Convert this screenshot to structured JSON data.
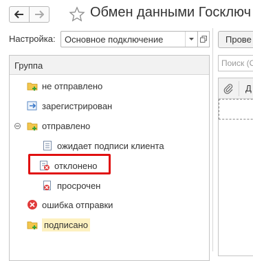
{
  "header": {
    "title": "Обмен данными Госключ"
  },
  "settings": {
    "label": "Настройка:",
    "selected": "Основное подключение"
  },
  "toolbar": {
    "check_label": "Прове"
  },
  "tree": {
    "column_header": "Группа",
    "items": [
      {
        "label": "не отправлено",
        "icon": "folder-plus-icon"
      },
      {
        "label": "зарегистрирован",
        "icon": "registered-arrow-icon"
      },
      {
        "label": "отправлено",
        "icon": "folder-plus-icon"
      },
      {
        "label": "ожидает подписи клиента",
        "icon": "document-icon"
      },
      {
        "label": "отклонено",
        "icon": "rejected-document-icon"
      },
      {
        "label": "просрочен",
        "icon": "expired-document-icon"
      },
      {
        "label": "ошибка отправки",
        "icon": "error-circle-icon"
      },
      {
        "label": "подписано",
        "icon": "folder-plus-icon"
      }
    ]
  },
  "right_panel": {
    "search_placeholder": "Поиск (С",
    "column_label": "Д"
  },
  "colors": {
    "selected_highlight": "#fdf1c0",
    "focus_frame": "#e01010",
    "folder_yellow": "#f3c64d",
    "plus_green": "#3aa43a",
    "error_red": "#e03a3a",
    "arrow_blue": "#3a78c9"
  }
}
